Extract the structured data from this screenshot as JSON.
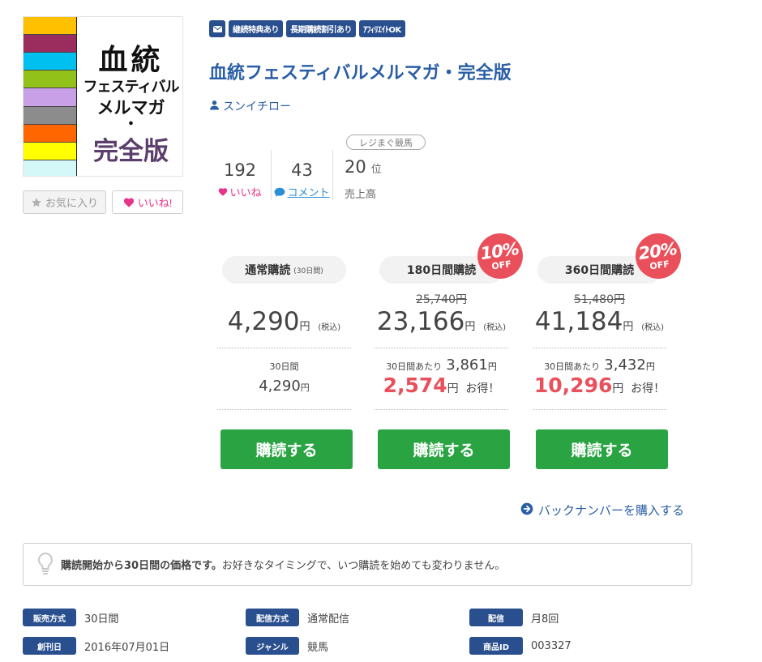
{
  "cover": {
    "stripe_colors": [
      "#ffc000",
      "#9b2d5e",
      "#00c0f0",
      "#92c21a",
      "#c8a0e8",
      "#8c8c8c",
      "#ff6600",
      "#ffff00",
      "#d4f8f8"
    ],
    "line1": "血統",
    "line2": "フェスティバル",
    "line3": "メルマガ",
    "line4": "・",
    "line5": "完全版"
  },
  "buttons": {
    "favorite": "お気に入り",
    "like": "いいね!"
  },
  "badges": [
    "継続特典あり",
    "長期購読割引あり",
    "ｱﾌｨﾘｴｲﾄOK"
  ],
  "title": "血統フェスティバルメルマガ・完全版",
  "author": "スンイチロー",
  "stats": {
    "likes": "192",
    "likes_label": "いいね",
    "comments": "43",
    "comments_label": "コメント",
    "rank_tag": "レジまぐ競馬",
    "rank": "20",
    "rank_unit": "位",
    "rank_label": "売上高"
  },
  "plans": [
    {
      "name": "通常購読",
      "period_note": "(30日間)",
      "discount": "",
      "original_price": "",
      "price": "4,290",
      "per_label": "30日間",
      "per_value": "4,290",
      "savings": "",
      "buy": "購読する"
    },
    {
      "name": "180日間購読",
      "period_note": "",
      "discount": "10%",
      "original_price": "25,740円",
      "price": "23,166",
      "per_label": "30日間あたり",
      "per_value": "3,861",
      "savings": "2,574",
      "buy": "購読する"
    },
    {
      "name": "360日間購読",
      "period_note": "",
      "discount": "20%",
      "original_price": "51,480円",
      "price": "41,184",
      "per_label": "30日間あたり",
      "per_value": "3,432",
      "savings": "10,296",
      "buy": "購読する"
    }
  ],
  "labels": {
    "yen": "円",
    "tax": "(税込)",
    "off": "OFF",
    "deal": "お得！"
  },
  "backnumber": "バックナンバーを購入する",
  "notice": {
    "bold": "購読開始から30日間の価格です。",
    "rest": "お好きなタイミングで、いつ購読を始めても変わりません。"
  },
  "meta": {
    "sale_method_key": "販売方式",
    "sale_method_val": "30日間",
    "delivery_method_key": "配信方式",
    "delivery_method_val": "通常配信",
    "delivery_key": "配信",
    "delivery_val": "月8回",
    "founded_key": "創刊日",
    "founded_val": "2016年07月01日",
    "genre_key": "ジャンル",
    "genre_val": "競馬",
    "product_id_key": "商品ID",
    "product_id_val": "003327"
  },
  "colors": {
    "brand_blue": "#2a4f8f",
    "link_blue": "#2a5ea5",
    "buy_green": "#2aa443",
    "discount_red": "#e9505b",
    "like_pink": "#e8338a"
  }
}
